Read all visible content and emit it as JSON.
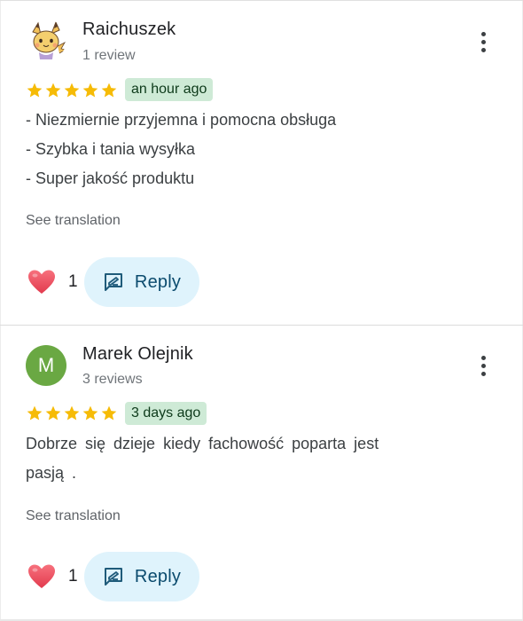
{
  "colors": {
    "star": "#f6bb06",
    "time_badge_bg": "#ceead6",
    "reply_bg": "#dff3fc",
    "avatar_m_bg": "#6aa843",
    "heart": "#e94b5d"
  },
  "reviews": [
    {
      "name": "Raichuszek",
      "review_count": "1 review",
      "avatar": {
        "type": "image",
        "icon": "raichu-avatar-icon"
      },
      "rating": 5,
      "time": "an hour ago",
      "lines": [
        "- Niezmiernie przyjemna i pomocna obsługa",
        "- Szybka i tania wysyłka",
        "- Super jakość produktu"
      ],
      "see_translation": "See translation",
      "likes": "1",
      "reply_label": "Reply"
    },
    {
      "name": "Marek Olejnik",
      "review_count": "3 reviews",
      "avatar": {
        "type": "letter",
        "letter": "M"
      },
      "rating": 5,
      "time": "3 days ago",
      "lines": [
        "Dobrze się dzieje  kiedy  fachowość  poparta  jest",
        "pasją ."
      ],
      "see_translation": "See translation",
      "likes": "1",
      "reply_label": "Reply"
    }
  ]
}
